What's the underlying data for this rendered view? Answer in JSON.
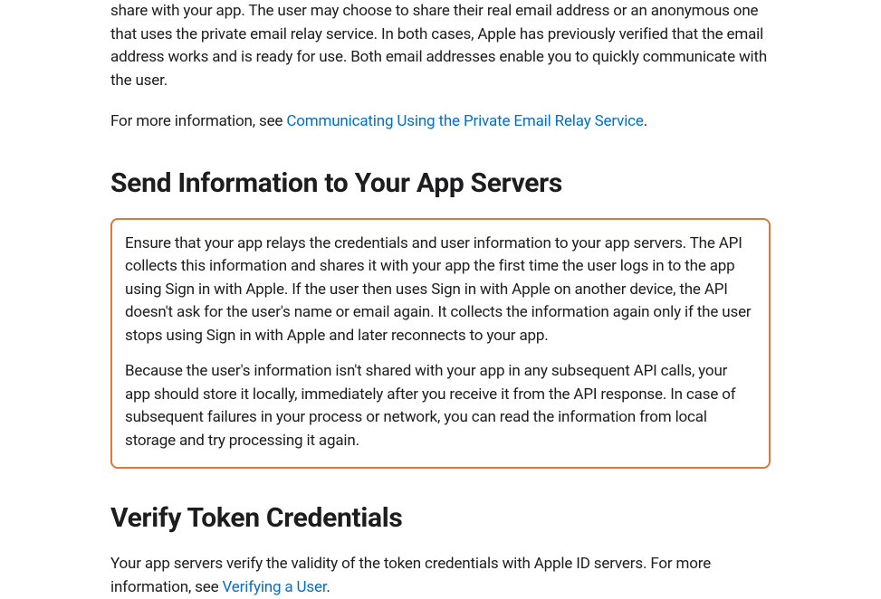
{
  "section_email_relay": {
    "paragraph_partial": "share with your app. The user may choose to share their real email address or an anonymous one that uses the private email relay service. In both cases, Apple has previously verified that the email address works and is ready for use. Both email addresses enable you to quickly communicate with the user.",
    "more_info_prefix": "For more information, see ",
    "link_text": "Communicating Using the Private Email Relay Service",
    "period": "."
  },
  "section_send_info": {
    "heading": "Send Information to Your App Servers",
    "para1": "Ensure that your app relays the credentials and user information to your app servers. The API collects this information and shares it with your app the first time the user logs in to the app using Sign in with Apple. If the user then uses Sign in with Apple on another device, the API doesn't ask for the user's name or email again. It collects the information again only if the user stops using Sign in with Apple and later reconnects to your app.",
    "para2": "Because the user's information isn't shared with your app in any subsequent API calls, your app should store it locally, immediately after you receive it from the API response. In case of subsequent failures in your process or network, you can read the information from local storage and try processing it again."
  },
  "section_verify_token": {
    "heading": "Verify Token Credentials",
    "para_prefix": "Your app servers verify the validity of the token credentials with Apple ID servers. For more information, see ",
    "link_text": "Verifying a User",
    "period": "."
  }
}
